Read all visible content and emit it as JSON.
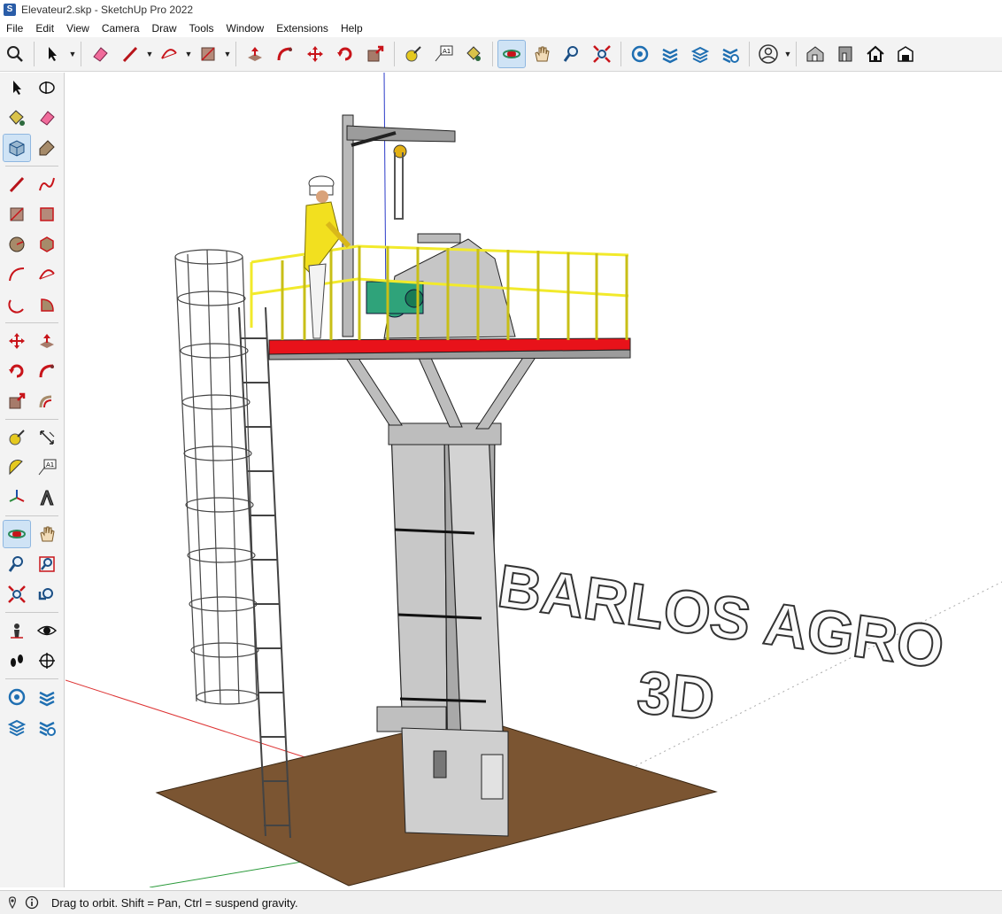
{
  "window": {
    "title": "Elevateur2.skp - SketchUp Pro 2022",
    "app_icon": "S"
  },
  "menu": {
    "items": [
      "File",
      "Edit",
      "View",
      "Camera",
      "Draw",
      "Tools",
      "Window",
      "Extensions",
      "Help"
    ]
  },
  "toolbar": {
    "icons": [
      "search-icon",
      "select-icon",
      "eraser-icon",
      "pencil-icon",
      "arc-icon",
      "rectangle-icon",
      "push-pull-icon",
      "follow-me-icon",
      "move-icon",
      "rotate-icon",
      "scale-icon",
      "tape-measure-icon",
      "text-icon",
      "paint-bucket-icon",
      "orbit-icon",
      "pan-icon",
      "zoom-icon",
      "zoom-extents-icon",
      "3d-warehouse-icon",
      "extension-warehouse-icon",
      "layout-icon",
      "extension-manager-icon",
      "user-icon",
      "iso-view-icon",
      "front-view-icon",
      "home-view-icon",
      "top-view-icon"
    ]
  },
  "left_toolbar": {
    "icons": [
      "select-icon",
      "orbit-tool-icon",
      "paint-bucket-icon",
      "eraser-icon",
      "component-icon",
      "tag-icon",
      "line-icon",
      "freehand-icon",
      "rectangle-icon",
      "rotated-rectangle-icon",
      "circle-icon",
      "polygon-icon",
      "arc-icon",
      "two-point-arc-icon",
      "three-point-arc-icon",
      "pie-icon",
      "move-icon",
      "push-pull-icon",
      "rotate-icon",
      "follow-me-icon",
      "scale-icon",
      "offset-icon",
      "tape-measure-icon",
      "dimension-icon",
      "protractor-icon",
      "text-icon",
      "axes-icon",
      "3d-text-icon",
      "orbit-icon",
      "pan-icon",
      "zoom-icon",
      "zoom-window-icon",
      "zoom-extents-icon",
      "previous-view-icon",
      "position-camera-icon",
      "look-around-icon",
      "walk-icon",
      "section-plane-icon",
      "3d-warehouse-icon",
      "extension-warehouse-icon",
      "layout-icon",
      "extension-manager-icon"
    ]
  },
  "scene": {
    "text_line1": "BARLOS AGRO",
    "text_line2": "3D"
  },
  "status": {
    "message": "Drag to orbit. Shift = Pan, Ctrl = suspend gravity.",
    "icons": [
      "geolocation-icon",
      "info-icon"
    ]
  },
  "colors": {
    "ground": "#7b5532",
    "railing": "#f2ea2b",
    "platform": "#e8121a",
    "steel": "#c4c4c4",
    "worker": "#f2e01f",
    "motor": "#2fa37a",
    "accent": "#2b6cb0"
  }
}
